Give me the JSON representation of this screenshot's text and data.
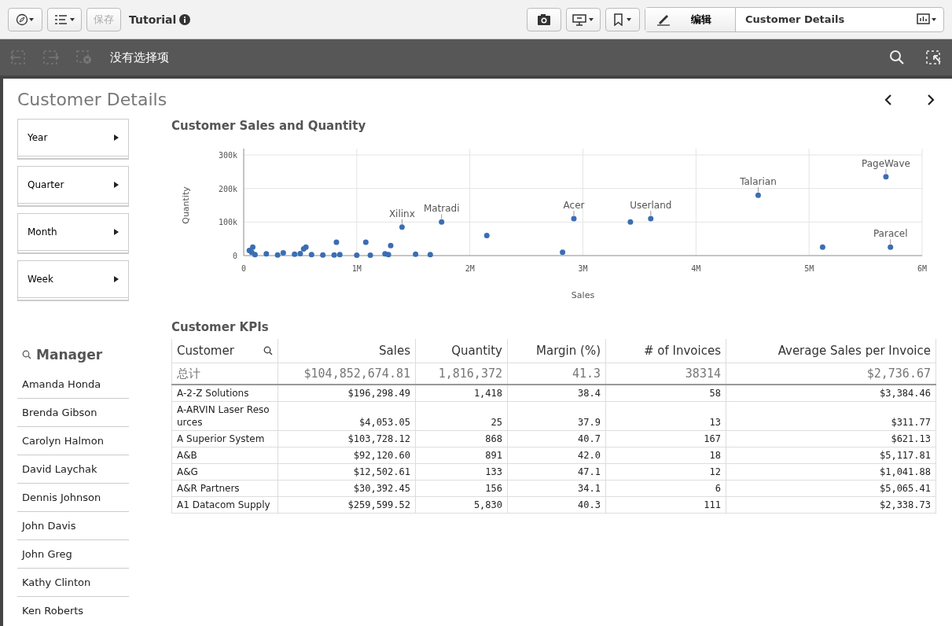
{
  "toolbar": {
    "save_label": "保存",
    "save_disabled": true,
    "app_title": "Tutorial",
    "edit_label": "编辑",
    "sheet_name": "Customer Details"
  },
  "selection_bar": {
    "text": "没有选择项"
  },
  "sheet": {
    "title": "Customer Details"
  },
  "filters": [
    {
      "label": "Year"
    },
    {
      "label": "Quarter"
    },
    {
      "label": "Month"
    },
    {
      "label": "Week"
    }
  ],
  "manager_list": {
    "title": "Manager",
    "items": [
      "Amanda Honda",
      "Brenda Gibson",
      "Carolyn Halmon",
      "David Laychak",
      "Dennis Johnson",
      "John Davis",
      "John Greg",
      "Kathy Clinton",
      "Ken Roberts"
    ]
  },
  "scatter": {
    "title": "Customer Sales and Quantity",
    "chart_data": {
      "type": "scatter",
      "xlabel": "Sales",
      "ylabel": "Quantity",
      "x": [
        0.05,
        0.07,
        0.08,
        0.1,
        0.2,
        0.3,
        0.35,
        0.45,
        0.5,
        0.53,
        0.55,
        0.6,
        0.7,
        0.8,
        0.82,
        0.85,
        1.0,
        1.08,
        1.12,
        1.25,
        1.28,
        1.3,
        1.4,
        1.52,
        1.65,
        1.75,
        2.15,
        2.82,
        2.92,
        3.42,
        3.6,
        4.55,
        5.12,
        5.68,
        5.72
      ],
      "values": [
        15,
        10,
        25,
        3,
        5,
        2,
        8,
        4,
        6,
        20,
        25,
        3,
        2,
        2,
        40,
        3,
        1,
        40,
        1,
        5,
        3,
        30,
        85,
        4,
        3,
        100,
        60,
        10,
        110,
        100,
        110,
        180,
        25,
        235,
        25
      ],
      "grid": true,
      "xlim": [
        0,
        6
      ],
      "ylim": [
        0,
        300
      ],
      "xticks": [
        {
          "value": 0,
          "label": "0"
        },
        {
          "value": 1,
          "label": "1M"
        },
        {
          "value": 2,
          "label": "2M"
        },
        {
          "value": 3,
          "label": "3M"
        },
        {
          "value": 4,
          "label": "4M"
        },
        {
          "value": 5,
          "label": "5M"
        },
        {
          "value": 6,
          "label": "6M"
        }
      ],
      "yticks": [
        {
          "value": 0,
          "label": "0"
        },
        {
          "value": 100,
          "label": "100k"
        },
        {
          "value": 200,
          "label": "200k"
        },
        {
          "value": 300,
          "label": "300k"
        }
      ],
      "annotations": [
        {
          "text": "Xilinx",
          "x": 1.4,
          "y": 85
        },
        {
          "text": "Matradi",
          "x": 1.75,
          "y": 100
        },
        {
          "text": "Acer",
          "x": 2.92,
          "y": 110
        },
        {
          "text": "Userland",
          "x": 3.6,
          "y": 110
        },
        {
          "text": "Talarian",
          "x": 4.55,
          "y": 180
        },
        {
          "text": "PageWave",
          "x": 5.68,
          "y": 235
        },
        {
          "text": "Paracel",
          "x": 5.72,
          "y": 25
        }
      ]
    }
  },
  "kpi_table": {
    "title": "Customer KPIs",
    "columns": [
      "Customer",
      "Sales",
      "Quantity",
      "Margin (%)",
      "# of Invoices",
      "Average Sales per Invoice"
    ],
    "totals": [
      "总计",
      "$104,852,674.81",
      "1,816,372",
      "41.3",
      "38314",
      "$2,736.67"
    ],
    "rows": [
      [
        "A-2-Z Solutions",
        "$196,298.49",
        "1,418",
        "38.4",
        "58",
        "$3,384.46"
      ],
      [
        "A-ARVIN Laser Resources",
        "$4,053.05",
        "25",
        "37.9",
        "13",
        "$311.77"
      ],
      [
        "A Superior System",
        "$103,728.12",
        "868",
        "40.7",
        "167",
        "$621.13"
      ],
      [
        "A&B",
        "$92,120.60",
        "891",
        "42.0",
        "18",
        "$5,117.81"
      ],
      [
        "A&G",
        "$12,502.61",
        "133",
        "47.1",
        "12",
        "$1,041.88"
      ],
      [
        "A&R Partners",
        "$30,392.45",
        "156",
        "34.1",
        "6",
        "$5,065.41"
      ],
      [
        "A1 Datacom Supply",
        "$259,599.52",
        "5,830",
        "40.3",
        "111",
        "$2,338.73"
      ]
    ]
  }
}
